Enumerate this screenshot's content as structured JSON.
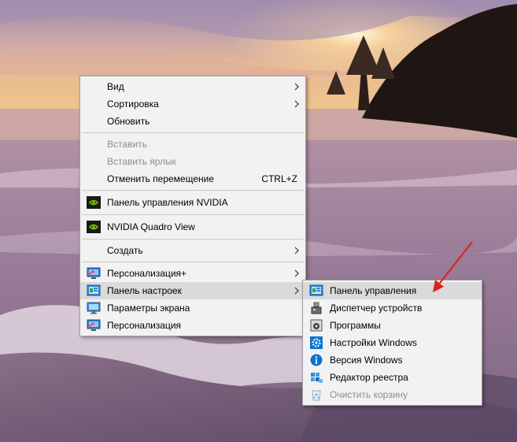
{
  "context_menu": {
    "items": [
      {
        "label": "Вид"
      },
      {
        "label": "Сортировка"
      },
      {
        "label": "Обновить"
      },
      {
        "label": "Вставить"
      },
      {
        "label": "Вставить ярлык"
      },
      {
        "label": "Отменить перемещение",
        "shortcut": "CTRL+Z"
      },
      {
        "label": "Панель управления NVIDIA"
      },
      {
        "label": "NVIDIA Quadro View"
      },
      {
        "label": "Создать"
      },
      {
        "label": "Персонализация+"
      },
      {
        "label": "Панель настроек"
      },
      {
        "label": "Параметры экрана"
      },
      {
        "label": "Персонализация"
      }
    ]
  },
  "submenu": {
    "items": [
      {
        "label": "Панель управления"
      },
      {
        "label": "Диспетчер устройств"
      },
      {
        "label": "Программы"
      },
      {
        "label": "Настройки Windows"
      },
      {
        "label": "Версия Windows"
      },
      {
        "label": "Редактор реестра"
      },
      {
        "label": "Очистить корзину"
      }
    ]
  },
  "colors": {
    "menu_bg": "#f2f2f2",
    "hover_bg": "#dadada",
    "disabled_text": "#8d8d8d",
    "annotation_arrow": "#e02020",
    "nvidia_green": "#76b900",
    "windows_blue": "#0a74d0"
  },
  "icons": {
    "nvidia": "nvidia-logo-icon",
    "personalize": "monitor-personalize-icon",
    "settings_panel": "control-panel-icon",
    "display": "display-icon",
    "device_manager": "device-manager-icon",
    "programs": "programs-icon",
    "gear": "gear-icon",
    "info": "info-icon",
    "registry": "registry-editor-icon",
    "recycle": "recycle-bin-icon",
    "submenu_arrow": "chevron-right-icon",
    "annotation_arrow": "red-arrow-icon"
  }
}
